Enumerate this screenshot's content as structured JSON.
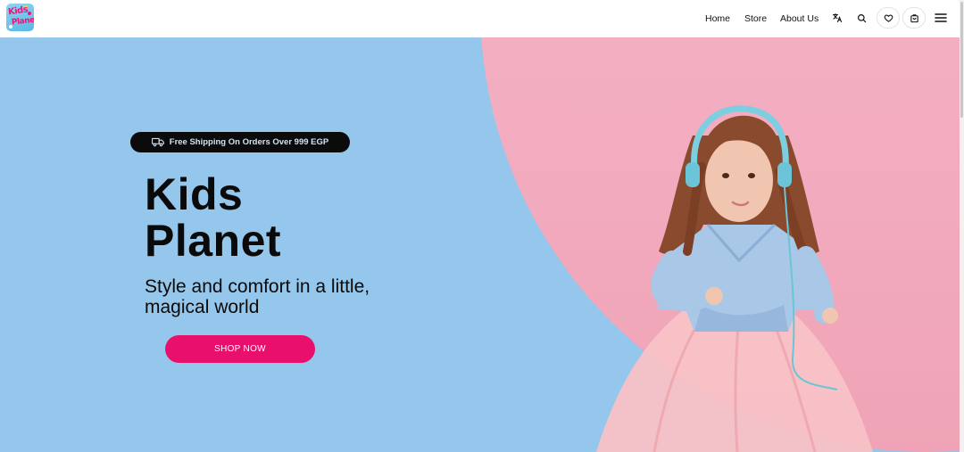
{
  "brand": {
    "logo_text_line1": "Kids",
    "logo_text_line2": "Planet"
  },
  "nav": {
    "items": [
      {
        "label": "Home"
      },
      {
        "label": "Store"
      },
      {
        "label": "About Us"
      }
    ]
  },
  "header_icons": [
    "translate-icon",
    "search-icon",
    "heart-icon",
    "cart-icon",
    "menu-icon"
  ],
  "hero": {
    "shipping_badge": "Free Shipping On Orders Over 999 EGP",
    "title_line1": "Kids",
    "title_line2": "Planet",
    "subtitle": "Style and comfort in a little, magical world",
    "cta_label": "SHOP NOW"
  },
  "colors": {
    "hero_background": "#95c6ec",
    "pink_panel": "#f3b4c6",
    "cta": "#e8106c",
    "badge": "#0b0b0b"
  }
}
